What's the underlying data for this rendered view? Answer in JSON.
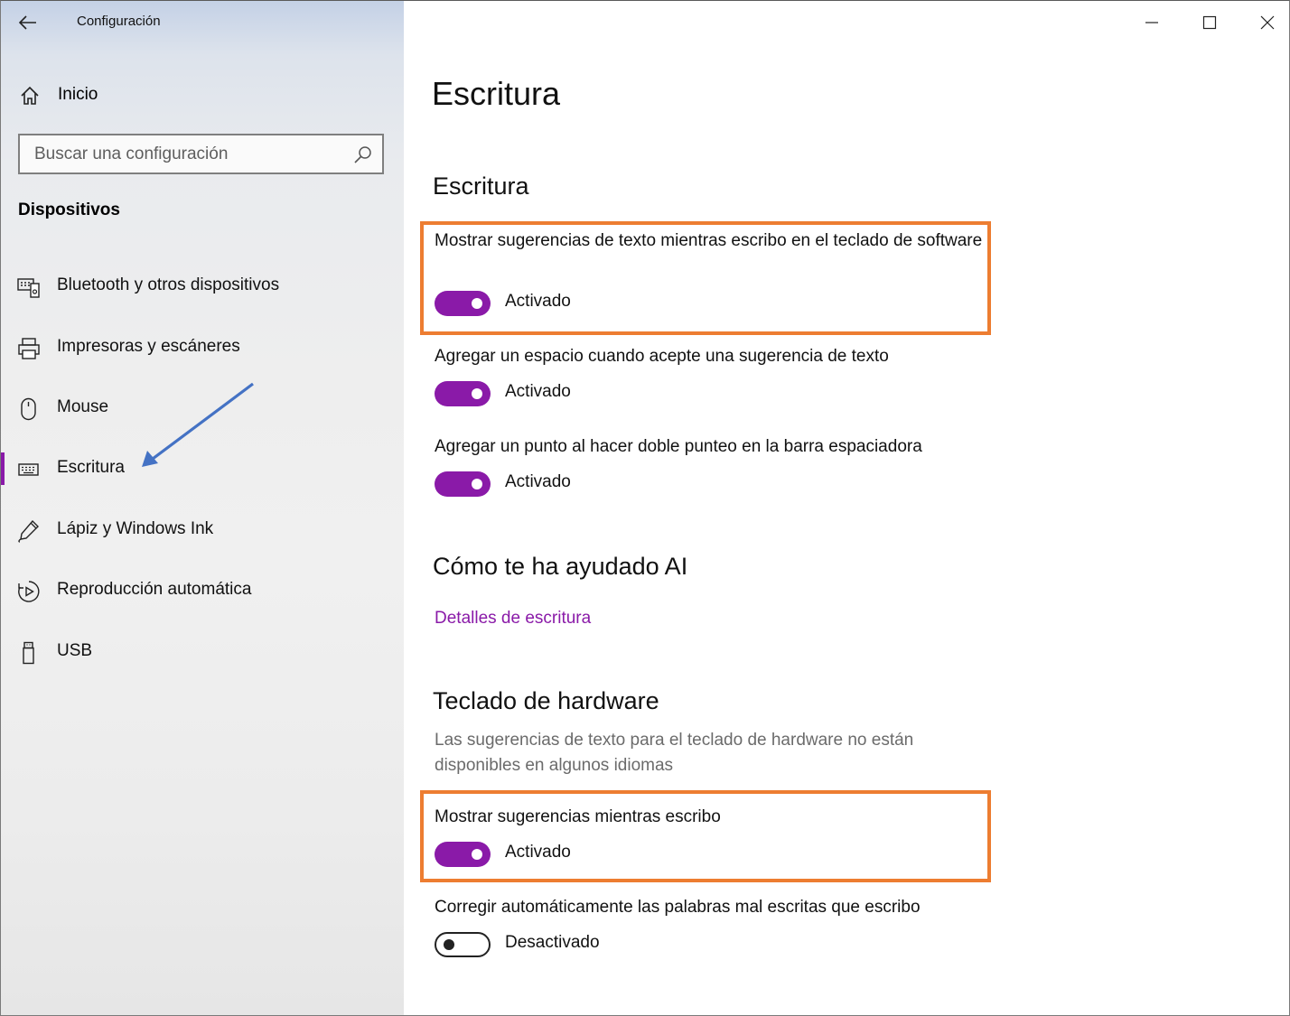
{
  "window": {
    "title": "Configuración",
    "controls": [
      "minimize-icon",
      "maximize-icon",
      "close-icon"
    ]
  },
  "sidebar": {
    "home_label": "Inicio",
    "search_placeholder": "Buscar una configuración",
    "section": "Dispositivos",
    "items": [
      {
        "label": "Bluetooth y otros dispositivos",
        "icon": "bluetooth-devices-icon"
      },
      {
        "label": "Impresoras y escáneres",
        "icon": "printer-icon"
      },
      {
        "label": "Mouse",
        "icon": "mouse-icon"
      },
      {
        "label": "Escritura",
        "icon": "keyboard-icon",
        "active": true
      },
      {
        "label": "Lápiz y Windows Ink",
        "icon": "pen-icon"
      },
      {
        "label": "Reproducción automática",
        "icon": "autoplay-icon"
      },
      {
        "label": "USB",
        "icon": "usb-icon"
      }
    ]
  },
  "main": {
    "page_title": "Escritura",
    "section_typing": "Escritura",
    "settings": [
      {
        "label": "Mostrar sugerencias de texto mientras escribo en el teclado de software",
        "state": "Activado",
        "on": true
      },
      {
        "label": "Agregar un espacio cuando acepte una sugerencia de texto",
        "state": "Activado",
        "on": true
      },
      {
        "label": "Agregar un punto al hacer doble punteo en la barra espaciadora",
        "state": "Activado",
        "on": true
      }
    ],
    "section_ai": "Cómo te ha ayudado AI",
    "link_details": "Detalles de escritura",
    "section_hardware": "Teclado de hardware",
    "hardware_desc": "Las sugerencias de texto para el teclado de hardware no están disponibles en algunos idiomas",
    "hardware_settings": [
      {
        "label": "Mostrar sugerencias mientras escribo",
        "state": "Activado",
        "on": true
      },
      {
        "label": "Corregir automáticamente las palabras mal escritas que escribo",
        "state": "Desactivado",
        "on": false
      }
    ]
  },
  "colors": {
    "accent": "#8a1aa8",
    "highlight": "#ed7d31",
    "annotation_arrow": "#4472c4"
  }
}
